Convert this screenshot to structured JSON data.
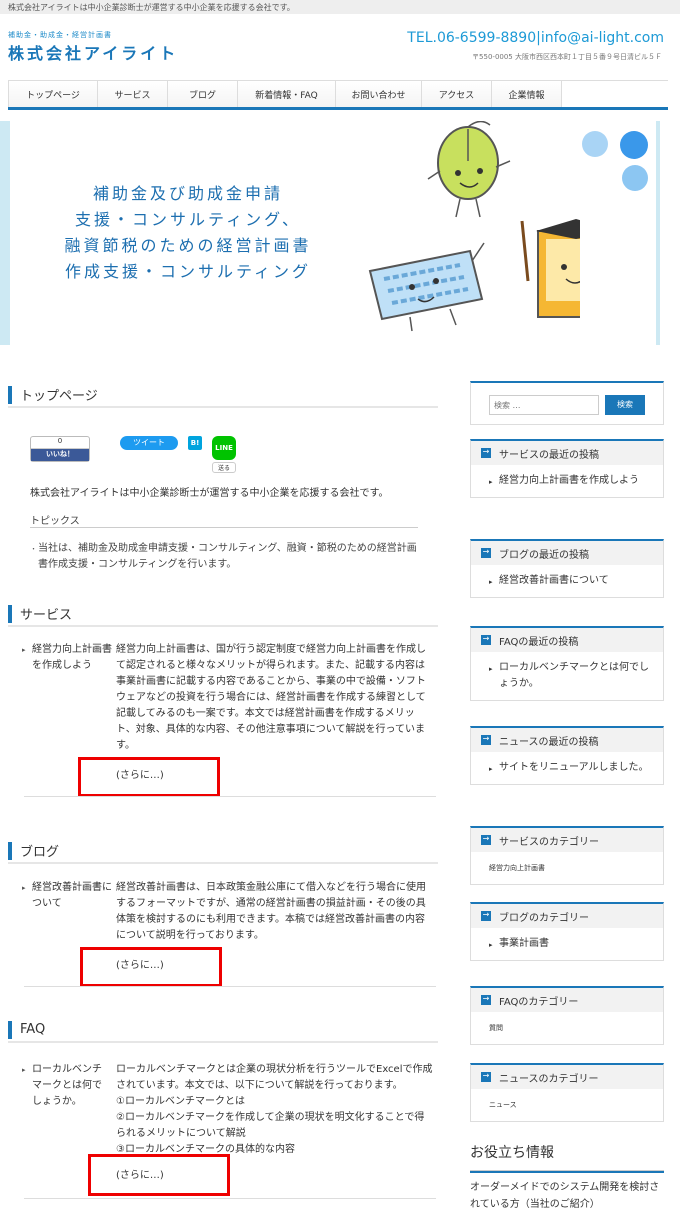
{
  "topbar": {
    "text": "株式会社アイライトは中小企業診断士が運営する中小企業を応援する会社です。"
  },
  "header": {
    "logo_sub": "補助金・助成金・経営計画書",
    "logo": "株式会社アイライト",
    "contact": "TEL.06-6599-8890|info@ai-light.com",
    "address": "〒550-0005 大阪市西区西本町１丁目５番９号日清ビル５Ｆ"
  },
  "nav": {
    "items": [
      "トップページ",
      "サービス",
      "ブログ",
      "新着情報・FAQ",
      "お問い合わせ",
      "アクセス",
      "企業情報"
    ]
  },
  "hero": {
    "lines": [
      "補助金及び助成金申請",
      "支援・コンサルティング、",
      "融資節税のための経営計画書",
      "作成支援・コンサルティング"
    ]
  },
  "page": {
    "title": "トップページ",
    "social": {
      "like_count": "0",
      "like": "いいね！",
      "tweet": "ツイート",
      "hatena": "B!",
      "line": "LINE",
      "line_send": "送る"
    },
    "intro": "株式会社アイライトは中小企業診断士が運営する中小企業を応援する会社です。",
    "topics_heading": "トピックス",
    "topics_text": "当社は、補助金及助成金申請支援・コンサルティング、融資・節税のための経営計画書作成支援・コンサルティングを行います。"
  },
  "sections": [
    {
      "title": "サービス",
      "entry_title": "経営力向上計画書を作成しよう",
      "entry_text": "経営力向上計画書は、国が行う認定制度で経営力向上計画書を作成して認定されると様々なメリットが得られます。また、記載する内容は事業計画書に記載する内容であることから、事業の中で設備・ソフトウェアなどの投資を行う場合には、経営計画書を作成する練習として記載してみるのも一案です。本文では経営計画書を作成するメリット、対象、具体的な内容、その他注意事項について解説を行っています。",
      "more": "(さらに…)"
    },
    {
      "title": "ブログ",
      "entry_title": "経営改善計画書について",
      "entry_text": "経営改善計画書は、日本政策金融公庫にて借入などを行う場合に使用するフォーマットですが、通常の経営計画書の損益計画・その後の具体策を検討するのにも利用できます。本稿では経営改善計画書の内容について説明を行っております。",
      "more": "(さらに…)"
    },
    {
      "title": "FAQ",
      "entry_title": "ローカルベンチマークとは何でしょうか。",
      "entry_text_lines": [
        "ローカルベンチマークとは企業の現状分析を行うツールでExcelで作成されています。本文では、以下について解説を行っております。",
        "①ローカルベンチマークとは",
        "②ローカルベンチマークを作成して企業の現状を明文化することで得られるメリットについて解説",
        "③ローカルベンチマークの具体的な内容"
      ],
      "more": "(さらに…)"
    }
  ],
  "sidebar": {
    "search_placeholder": "検索 …",
    "search_button": "検索",
    "widgets": [
      {
        "title": "サービスの最近の投稿",
        "item": "経営力向上計画書を作成しよう"
      },
      {
        "title": "ブログの最近の投稿",
        "item": "経営改善計画書について"
      },
      {
        "title": "FAQの最近の投稿",
        "item": "ローカルベンチマークとは何でしょうか。"
      },
      {
        "title": "ニュースの最近の投稿",
        "item": "サイトをリニューアルしました。"
      },
      {
        "title": "サービスのカテゴリー",
        "item": "経営力向上計画書"
      },
      {
        "title": "ブログのカテゴリー",
        "item": "事業計画書"
      },
      {
        "title": "FAQのカテゴリー",
        "item": "質問"
      },
      {
        "title": "ニュースのカテゴリー",
        "item": "ニュース"
      }
    ],
    "useful_title": "お役立ち情報",
    "useful_text": "オーダーメイドでのシステム開発を検討されている方（当社のご紹介）"
  },
  "colors": {
    "accent": "#1a77b8",
    "hero_text": "#1d6fb0",
    "highlight_box": "#ee0000"
  }
}
